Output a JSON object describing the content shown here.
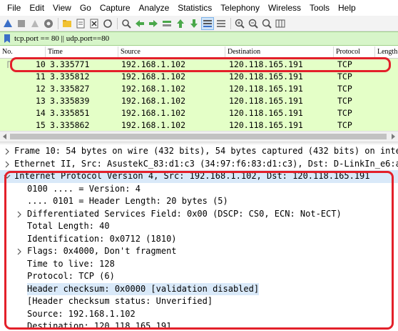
{
  "menu": [
    "File",
    "Edit",
    "View",
    "Go",
    "Capture",
    "Analyze",
    "Statistics",
    "Telephony",
    "Wireless",
    "Tools",
    "Help"
  ],
  "filter": {
    "value": "tcp.port == 80 || udp.port==80"
  },
  "packet_list": {
    "columns": [
      "No.",
      "Time",
      "Source",
      "Destination",
      "Protocol",
      "Length"
    ],
    "rows": [
      {
        "no": "10",
        "time": "3.335771",
        "source": "192.168.1.102",
        "destination": "120.118.165.191",
        "protocol": "TCP"
      },
      {
        "no": "11",
        "time": "3.335812",
        "source": "192.168.1.102",
        "destination": "120.118.165.191",
        "protocol": "TCP"
      },
      {
        "no": "12",
        "time": "3.335827",
        "source": "192.168.1.102",
        "destination": "120.118.165.191",
        "protocol": "TCP"
      },
      {
        "no": "13",
        "time": "3.335839",
        "source": "192.168.1.102",
        "destination": "120.118.165.191",
        "protocol": "TCP"
      },
      {
        "no": "14",
        "time": "3.335851",
        "source": "192.168.1.102",
        "destination": "120.118.165.191",
        "protocol": "TCP"
      },
      {
        "no": "15",
        "time": "3.335862",
        "source": "192.168.1.102",
        "destination": "120.118.165.191",
        "protocol": "TCP"
      }
    ]
  },
  "details": {
    "frame": "Frame 10: 54 bytes on wire (432 bits), 54 bytes captured (432 bits) on inte",
    "ethernet": "Ethernet II, Src: AsustekC_83:d1:c3 (34:97:f6:83:d1:c3), Dst: D-LinkIn_e6:a",
    "ip": "Internet Protocol Version 4, Src: 192.168.1.102, Dst: 120.118.165.191",
    "version": "0100 .... = Version: 4",
    "header_length": ".... 0101 = Header Length: 20 bytes (5)",
    "dsf": "Differentiated Services Field: 0x00 (DSCP: CS0, ECN: Not-ECT)",
    "total_length": "Total Length: 40",
    "identification": "Identification: 0x0712 (1810)",
    "flags": "Flags: 0x4000, Don't fragment",
    "ttl": "Time to live: 128",
    "protocol": "Protocol: TCP (6)",
    "checksum": "Header checksum: 0x0000 [validation disabled]",
    "checksum_status": "[Header checksum status: Unverified]",
    "source": "Source: 192.168.1.102",
    "destination": "Destination: 120.118.165.191"
  },
  "colors": {
    "row_bg": "#e4ffc7",
    "filter_bg": "#d7f5c9",
    "highlight_box": "#e3202a",
    "selected_line": "#d9e9f9"
  },
  "toolbar_icons": [
    "shark-fin-start-icon",
    "stop-icon",
    "restart-icon",
    "options-gear-icon",
    "open-file-icon",
    "save-file-icon",
    "close-file-icon",
    "reload-icon",
    "find-icon",
    "back-arrow-icon",
    "forward-arrow-icon",
    "go-to-packet-icon",
    "first-packet-icon",
    "last-packet-icon",
    "autoscroll-icon",
    "colorize-icon",
    "zoom-in-icon",
    "zoom-out-icon",
    "zoom-normal-icon",
    "resize-columns-icon"
  ]
}
